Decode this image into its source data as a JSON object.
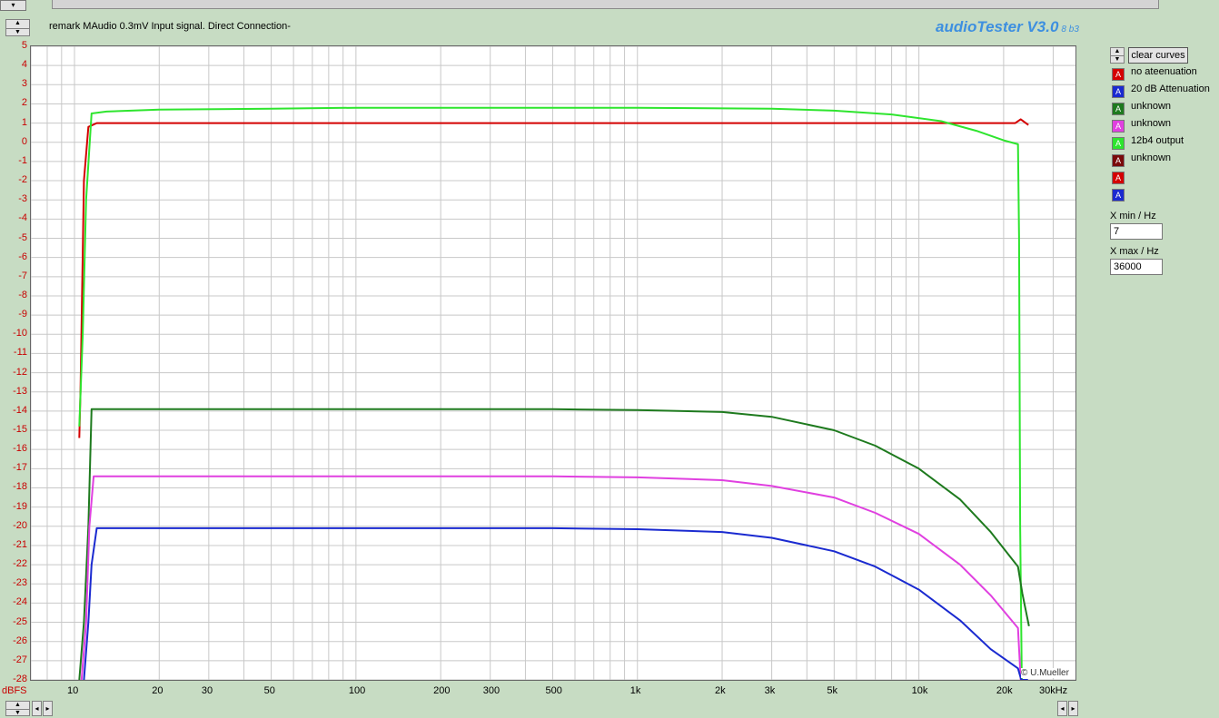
{
  "header": {
    "remark": "remark MAudio  0.3mV Input signal.  Direct Connection-",
    "app_title": "audioTester V3.0",
    "app_version": "8 b3",
    "copyright": "© U.Mueller"
  },
  "controls": {
    "clear_curves_label": "clear curves",
    "xmin_label": "X min / Hz",
    "xmin_value": "7",
    "xmax_label": "X max / Hz",
    "xmax_value": "36000"
  },
  "legend": [
    {
      "name": "no ateenuation",
      "color": "#d40000"
    },
    {
      "name": "20 dB Attenuation",
      "color": "#1a2ad0"
    },
    {
      "name": "unknown",
      "color": "#1e7a1e"
    },
    {
      "name": "unknown",
      "color": "#e040e0"
    },
    {
      "name": "12b4 output",
      "color": "#2ee52e"
    },
    {
      "name": "unknown",
      "color": "#7a0a0a"
    },
    {
      "name": "",
      "color": "#d40000"
    },
    {
      "name": "",
      "color": "#1a2ad0"
    }
  ],
  "chart_data": {
    "type": "line",
    "x_scale": "log",
    "xlim": [
      7,
      36000
    ],
    "ylim": [
      -28,
      5
    ],
    "ylabel": "dBFS",
    "xlabel": "",
    "grid": true,
    "y_ticks": [
      "5",
      "4",
      "3",
      "2",
      "1",
      "0",
      "-1",
      "-2",
      "-3",
      "-4",
      "-5",
      "-6",
      "-7",
      "-8",
      "-9",
      "-10",
      "-11",
      "-12",
      "-13",
      "-14",
      "-15",
      "-16",
      "-17",
      "-18",
      "-19",
      "-20",
      "-21",
      "-22",
      "-23",
      "-24",
      "-25",
      "-26",
      "-27",
      "-28"
    ],
    "x_ticks": [
      {
        "v": 10,
        "label": "10"
      },
      {
        "v": 20,
        "label": "20"
      },
      {
        "v": 30,
        "label": "30"
      },
      {
        "v": 50,
        "label": "50"
      },
      {
        "v": 100,
        "label": "100"
      },
      {
        "v": 200,
        "label": "200"
      },
      {
        "v": 300,
        "label": "300"
      },
      {
        "v": 500,
        "label": "500"
      },
      {
        "v": 1000,
        "label": "1k"
      },
      {
        "v": 2000,
        "label": "2k"
      },
      {
        "v": 3000,
        "label": "3k"
      },
      {
        "v": 5000,
        "label": "5k"
      },
      {
        "v": 10000,
        "label": "10k"
      },
      {
        "v": 20000,
        "label": "20k"
      },
      {
        "v": 36000,
        "label": "30kHz"
      }
    ],
    "series": [
      {
        "name": "no ateenuation",
        "color": "#d40000",
        "x": [
          10.4,
          10.5,
          10.8,
          11.2,
          12,
          20,
          100,
          1000,
          5000,
          10000,
          20000,
          22000,
          23000,
          24500
        ],
        "y": [
          -15.4,
          -13,
          -2,
          0.8,
          1.0,
          1.0,
          1.0,
          1.0,
          1.0,
          1.0,
          1.0,
          1.0,
          1.2,
          0.9
        ]
      },
      {
        "name": "12b4 output",
        "color": "#2ee52e",
        "x": [
          10.4,
          10.7,
          11.0,
          11.5,
          13,
          20,
          50,
          100,
          500,
          1000,
          3000,
          5000,
          8000,
          12000,
          16000,
          20000,
          22500,
          22700,
          22900,
          23200
        ],
        "y": [
          -14.8,
          -10,
          -3,
          1.5,
          1.6,
          1.7,
          1.75,
          1.8,
          1.8,
          1.8,
          1.75,
          1.65,
          1.45,
          1.1,
          0.6,
          0.1,
          -0.1,
          -5,
          -20,
          -28
        ]
      },
      {
        "name": "unknown",
        "color": "#1e7a1e",
        "x": [
          10.4,
          10.8,
          11.2,
          11.5,
          20,
          100,
          500,
          1000,
          2000,
          3000,
          5000,
          7000,
          10000,
          14000,
          18000,
          22500,
          23300,
          24600
        ],
        "y": [
          -28,
          -25,
          -20,
          -13.9,
          -13.9,
          -13.9,
          -13.9,
          -13.95,
          -14.05,
          -14.3,
          -15.0,
          -15.8,
          -17.0,
          -18.6,
          -20.3,
          -22.1,
          -23.5,
          -25.2
        ]
      },
      {
        "name": "unknown",
        "color": "#e040e0",
        "x": [
          10.6,
          11.0,
          11.3,
          11.7,
          20,
          100,
          500,
          1000,
          2000,
          3000,
          5000,
          7000,
          10000,
          14000,
          18000,
          22500,
          23000
        ],
        "y": [
          -28,
          -25,
          -20,
          -17.4,
          -17.4,
          -17.4,
          -17.4,
          -17.45,
          -17.6,
          -17.9,
          -18.5,
          -19.3,
          -20.4,
          -22.0,
          -23.6,
          -25.3,
          -28
        ]
      },
      {
        "name": "20 dB Attenuation",
        "color": "#1a2ad0",
        "x": [
          10.8,
          11.2,
          11.5,
          12,
          20,
          100,
          500,
          1000,
          2000,
          3000,
          5000,
          7000,
          10000,
          14000,
          18000,
          22500,
          23100,
          24400
        ],
        "y": [
          -28,
          -25,
          -22,
          -20.1,
          -20.1,
          -20.1,
          -20.1,
          -20.15,
          -20.3,
          -20.6,
          -21.3,
          -22.1,
          -23.3,
          -24.9,
          -26.4,
          -27.4,
          -28,
          -28
        ]
      }
    ]
  }
}
